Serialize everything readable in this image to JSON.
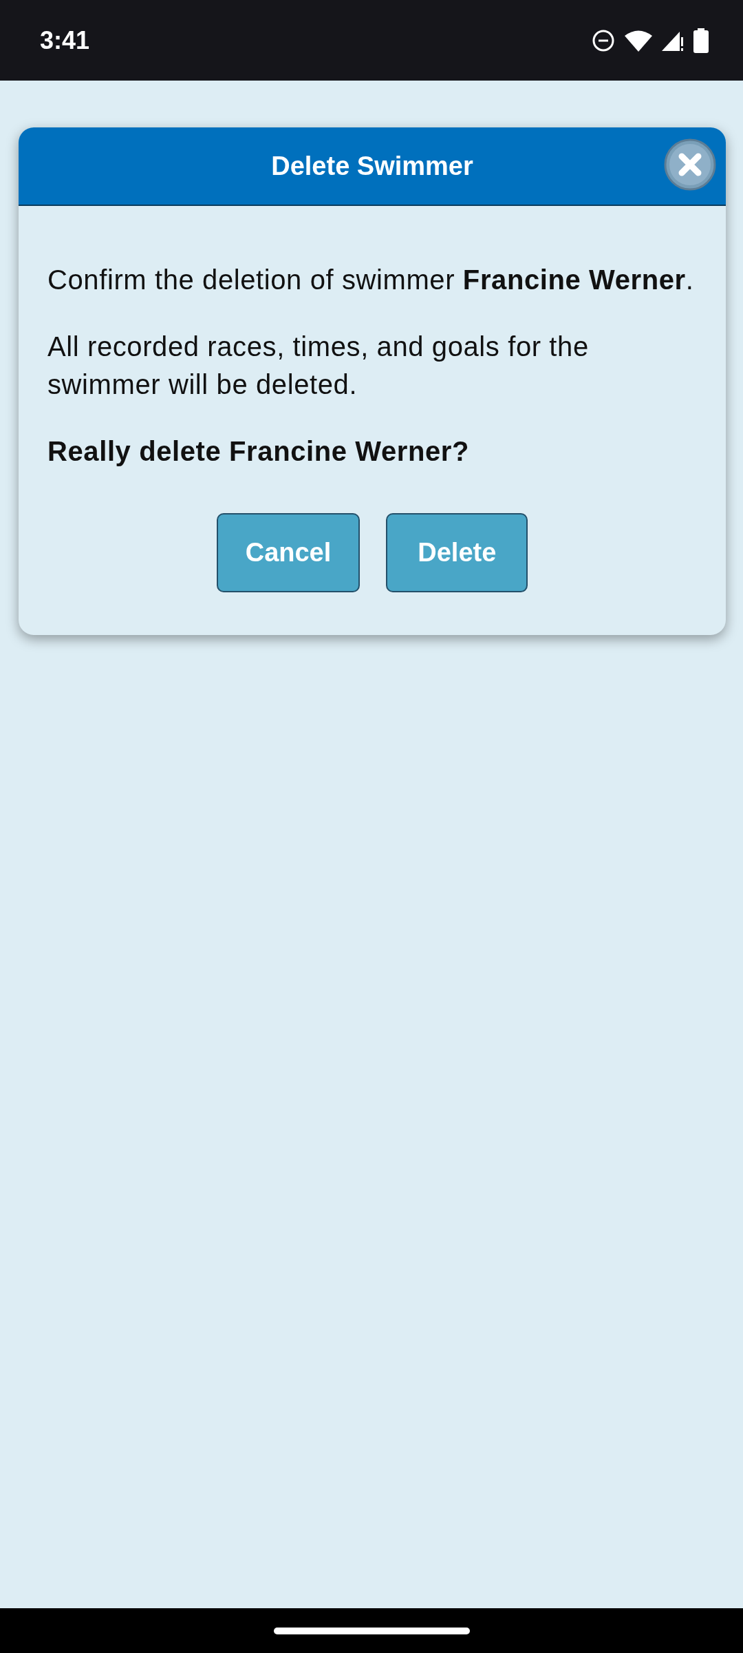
{
  "status_bar": {
    "time": "3:41"
  },
  "dialog": {
    "title": "Delete Swimmer",
    "paragraphs": [
      {
        "text": "Confirm the deletion of swimmer **Francine Werner**.",
        "bold": false
      },
      {
        "text": "All recorded races, times, and goals for the swimmer will be deleted.",
        "bold": false
      },
      {
        "text": "Really delete Francine Werner?",
        "bold": true
      }
    ],
    "buttons": [
      {
        "label": "Cancel"
      },
      {
        "label": "Delete"
      }
    ]
  }
}
